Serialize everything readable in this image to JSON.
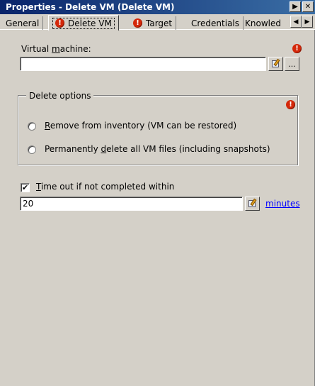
{
  "window": {
    "title": "Properties - Delete VM (Delete VM)"
  },
  "tabs": [
    {
      "label": "General",
      "has_error": false,
      "active": false
    },
    {
      "label": "Delete VM",
      "has_error": true,
      "active": true
    },
    {
      "label": "Target",
      "has_error": true,
      "active": false
    },
    {
      "label": "Credentials",
      "has_error": false,
      "active": false
    },
    {
      "label": "Knowled",
      "has_error": false,
      "active": false
    }
  ],
  "virtual_machine": {
    "label_prefix": "Virtual ",
    "label_underlined": "m",
    "label_suffix": "achine:",
    "value": "",
    "ellipsis": "..."
  },
  "delete_options": {
    "title": "Delete options",
    "option1_underlined": "R",
    "option1_rest": "emove from inventory (VM can be restored)",
    "option2_prefix": "Permanently ",
    "option2_underlined": "d",
    "option2_rest": "elete all VM files (including snapshots)"
  },
  "timeout": {
    "checked": true,
    "label_underlined": "T",
    "label_rest": "ime out if not completed within",
    "value": "20",
    "unit_link": "minutes"
  },
  "icons": {
    "error": "!",
    "check": "✔",
    "next": "▶",
    "close": "✕",
    "scroll_left": "◀",
    "scroll_right": "▶"
  },
  "colors": {
    "title_bar": "#0a246a",
    "error": "#d4280a",
    "link": "#0000ff",
    "face": "#d4d0c8"
  }
}
